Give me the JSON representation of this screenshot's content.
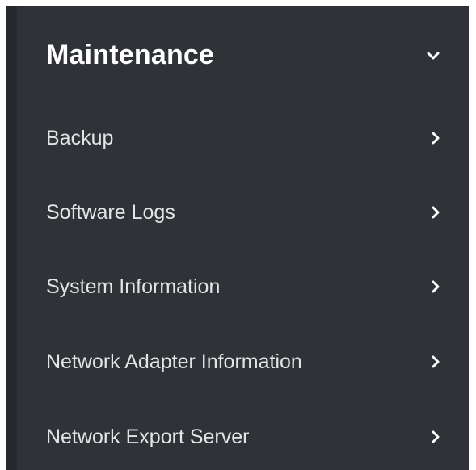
{
  "section": {
    "title": "Maintenance",
    "toggle_icon": "chevron-down-icon",
    "expanded": true
  },
  "items": [
    {
      "label": "Backup",
      "icon": "chevron-right-icon"
    },
    {
      "label": "Software Logs",
      "icon": "chevron-right-icon"
    },
    {
      "label": "System Information",
      "icon": "chevron-right-icon"
    },
    {
      "label": "Network Adapter Information",
      "icon": "chevron-right-icon"
    },
    {
      "label": "Network Export Server",
      "icon": "chevron-right-icon"
    }
  ],
  "colors": {
    "panel_background": "#2f3236",
    "panel_edge": "#26292d",
    "title_text": "#ffffff",
    "item_text": "#e3e4e6"
  }
}
